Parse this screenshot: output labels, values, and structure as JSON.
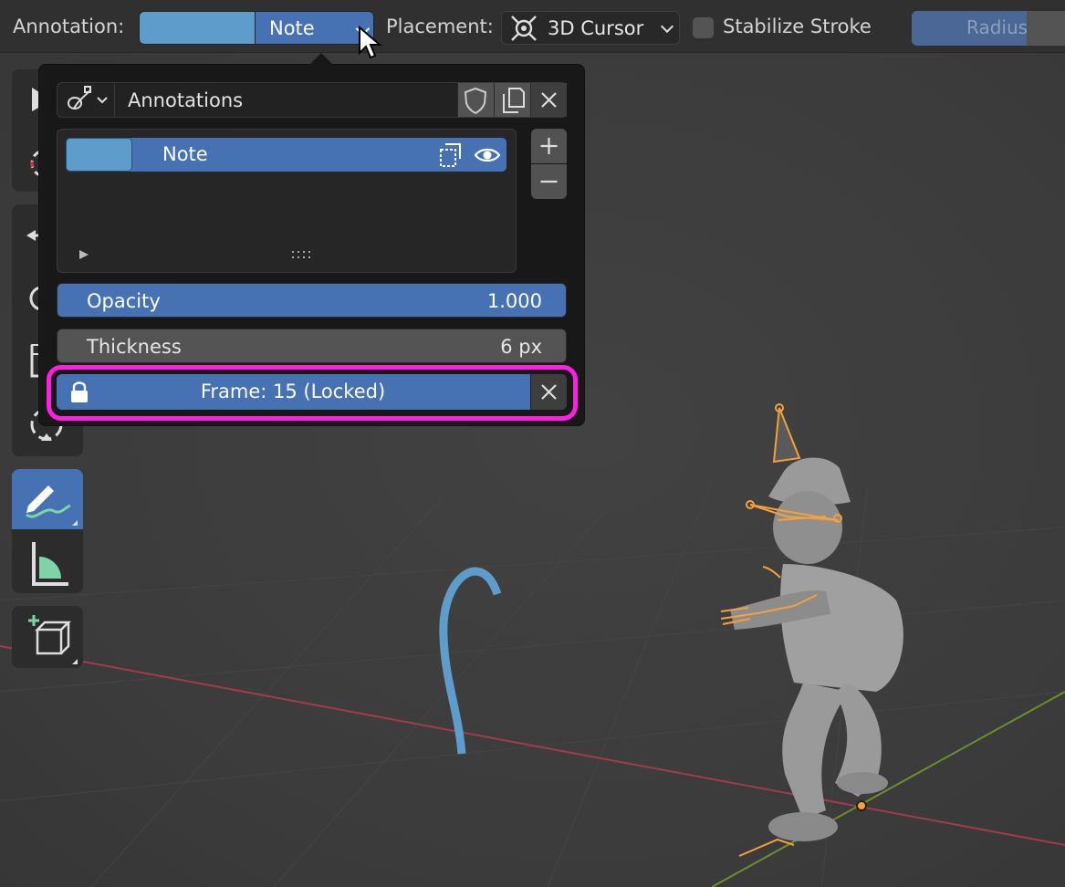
{
  "header": {
    "annotation_label": "Annotation:",
    "layer_name": "Note",
    "annotation_color": "#5e9ccb",
    "placement_label": "Placement:",
    "placement_value": "3D Cursor",
    "stabilize_label": "Stabilize Stroke",
    "stabilize_checked": false,
    "radius_label": "Radius"
  },
  "popover": {
    "datablock_name": "Annotations",
    "layers": [
      {
        "name": "Note",
        "color": "#5e9ccb",
        "visible": true,
        "selected": true
      }
    ],
    "opacity": {
      "label": "Opacity",
      "value": "1.000"
    },
    "thickness": {
      "label": "Thickness",
      "value": "6 px"
    },
    "frame_lock": {
      "label": "Frame: 15 (Locked)"
    }
  },
  "toolbar": {
    "active_tool": "annotate",
    "tools": [
      "select",
      "cursor",
      "move",
      "rotate",
      "scale",
      "transform",
      "annotate",
      "measure",
      "add-cube"
    ]
  },
  "colors": {
    "accent": "#4671b3",
    "highlight": "#ff1fe0",
    "rig": "#f5a03a",
    "annotation_stroke": "#5e9ccb"
  }
}
